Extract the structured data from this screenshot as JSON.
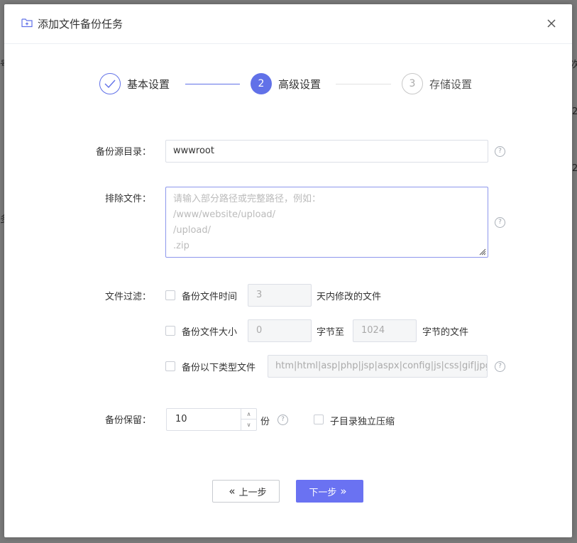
{
  "dialog": {
    "title": "添加文件备份任务",
    "icons": {
      "folder": "folder-plus-icon",
      "close": "close-icon"
    }
  },
  "steps": [
    {
      "number": "1",
      "label": "基本设置",
      "state": "done"
    },
    {
      "number": "2",
      "label": "高级设置",
      "state": "active"
    },
    {
      "number": "3",
      "label": "存储设置",
      "state": "pending"
    }
  ],
  "form": {
    "source_dir": {
      "label": "备份源目录：",
      "value": "wwwroot"
    },
    "exclude": {
      "label": "排除文件：",
      "placeholder_lines": [
        "请输入部分路径或完整路径，例如：",
        "/www/website/upload/",
        "/upload/",
        ".zip"
      ]
    },
    "filter": {
      "label": "文件过滤：",
      "by_time": {
        "checkbox_label": "备份文件时间",
        "value": "3",
        "suffix": "天内修改的文件"
      },
      "by_size": {
        "checkbox_label": "备份文件大小",
        "min": "0",
        "mid": "字节至",
        "max": "1024",
        "suffix": "字节的文件"
      },
      "by_type": {
        "checkbox_label": "备份以下类型文件",
        "value": "htm|html|asp|php|jsp|aspx|config|js|css|gif|jpg|p"
      }
    },
    "retain": {
      "label": "备份保留：",
      "value": "10",
      "unit": "份",
      "sub_compress_label": "子目录独立压缩"
    }
  },
  "buttons": {
    "prev": "上一步",
    "next": "下一步"
  },
  "colors": {
    "accent": "#6171e8",
    "button_primary": "#6a72f2"
  }
}
